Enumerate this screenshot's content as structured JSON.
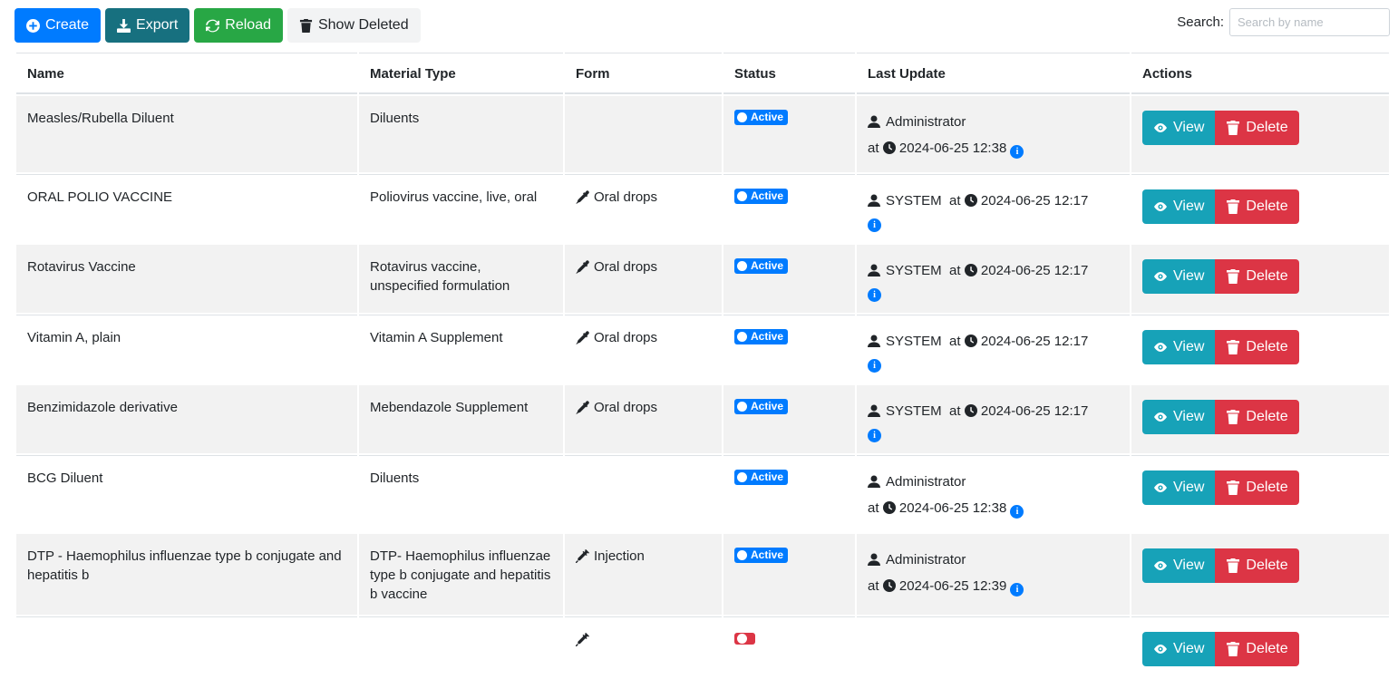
{
  "toolbar": {
    "create_label": "Create",
    "export_label": "Export",
    "reload_label": "Reload",
    "show_deleted_label": "Show Deleted"
  },
  "search": {
    "label": "Search:",
    "placeholder": "Search by name",
    "value": ""
  },
  "table": {
    "columns": {
      "name": "Name",
      "material_type": "Material Type",
      "form": "Form",
      "status": "Status",
      "last_update": "Last Update",
      "actions": "Actions"
    },
    "at_label": "at",
    "info_glyph": "i",
    "view_label": "View",
    "delete_label": "Delete",
    "rows": [
      {
        "name": "Measles/Rubella Diluent",
        "material_type": "Diluents",
        "form": "",
        "form_icon": "",
        "status": "Active",
        "user": "Administrator",
        "timestamp": "2024-06-25 12:38",
        "layout": "two-line"
      },
      {
        "name": "ORAL POLIO VACCINE",
        "material_type": "Poliovirus vaccine, live, oral",
        "form": "Oral drops",
        "form_icon": "eyedropper-icon",
        "status": "Active",
        "user": "SYSTEM",
        "timestamp": "2024-06-25 12:17",
        "layout": "inline"
      },
      {
        "name": "Rotavirus Vaccine",
        "material_type": "Rotavirus vaccine, unspecified formulation",
        "form": "Oral drops",
        "form_icon": "eyedropper-icon",
        "status": "Active",
        "user": "SYSTEM",
        "timestamp": "2024-06-25 12:17",
        "layout": "inline"
      },
      {
        "name": "Vitamin A, plain",
        "material_type": "Vitamin A Supplement",
        "form": "Oral drops",
        "form_icon": "eyedropper-icon",
        "status": "Active",
        "user": "SYSTEM",
        "timestamp": "2024-06-25 12:17",
        "layout": "inline"
      },
      {
        "name": "Benzimidazole derivative",
        "material_type": "Mebendazole Supplement",
        "form": "Oral drops",
        "form_icon": "eyedropper-icon",
        "status": "Active",
        "user": "SYSTEM",
        "timestamp": "2024-06-25 12:17",
        "layout": "inline"
      },
      {
        "name": "BCG Diluent",
        "material_type": "Diluents",
        "form": "",
        "form_icon": "",
        "status": "Active",
        "user": "Administrator",
        "timestamp": "2024-06-25 12:38",
        "layout": "two-line"
      },
      {
        "name": "DTP - Haemophilus influenzae type b conjugate and hepatitis b",
        "material_type": "DTP- Haemophilus influenzae type b conjugate and hepatitis b vaccine",
        "form": "Injection",
        "form_icon": "syringe-icon",
        "status": "Active",
        "user": "Administrator",
        "timestamp": "2024-06-25 12:39",
        "layout": "two-line"
      },
      {
        "name": "",
        "material_type": "",
        "form": "",
        "form_icon": "syringe-icon",
        "status": "",
        "status_variant": "obsolete",
        "user": "",
        "timestamp": "",
        "layout": "two-line"
      }
    ]
  },
  "colors": {
    "primary": "#007bff",
    "export": "#17707f",
    "success": "#28a745",
    "info": "#17a2b8",
    "danger": "#dc3545",
    "stripe": "#f2f2f2"
  }
}
